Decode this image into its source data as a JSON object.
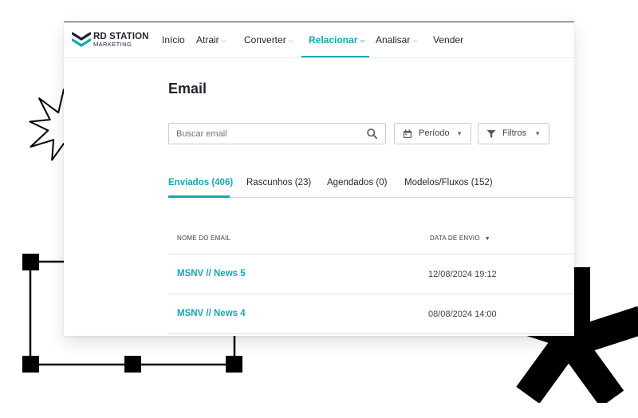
{
  "brand": {
    "line1": "RD STATION",
    "line2": "MARKETING"
  },
  "nav": {
    "items": [
      {
        "label": "Início",
        "dropdown": false,
        "active": false
      },
      {
        "label": "Atrair",
        "dropdown": true,
        "active": false
      },
      {
        "label": "Converter",
        "dropdown": true,
        "active": false
      },
      {
        "label": "Relacionar",
        "dropdown": true,
        "active": true
      },
      {
        "label": "Analisar",
        "dropdown": true,
        "active": false
      },
      {
        "label": "Vender",
        "dropdown": false,
        "active": false
      }
    ]
  },
  "page": {
    "title": "Email"
  },
  "search": {
    "placeholder": "Buscar email",
    "value": ""
  },
  "filters": {
    "period_label": "Período",
    "filters_label": "Filtros"
  },
  "tabs": [
    {
      "label": "Enviados (406)",
      "active": true
    },
    {
      "label": "Rascunhos (23)",
      "active": false
    },
    {
      "label": "Agendados (0)",
      "active": false
    },
    {
      "label": "Modelos/Fluxos (152)",
      "active": false
    }
  ],
  "table": {
    "columns": [
      "NOME DO EMAIL",
      "DATA DE ENVIO"
    ],
    "rows": [
      {
        "name": "MSNV // News 5",
        "date": "12/08/2024 19:12"
      },
      {
        "name": "MSNV // News 4",
        "date": "08/08/2024 14:00"
      }
    ]
  },
  "colors": {
    "accent": "#12a8b8",
    "text": "#1e2430",
    "decor": "#000000"
  }
}
